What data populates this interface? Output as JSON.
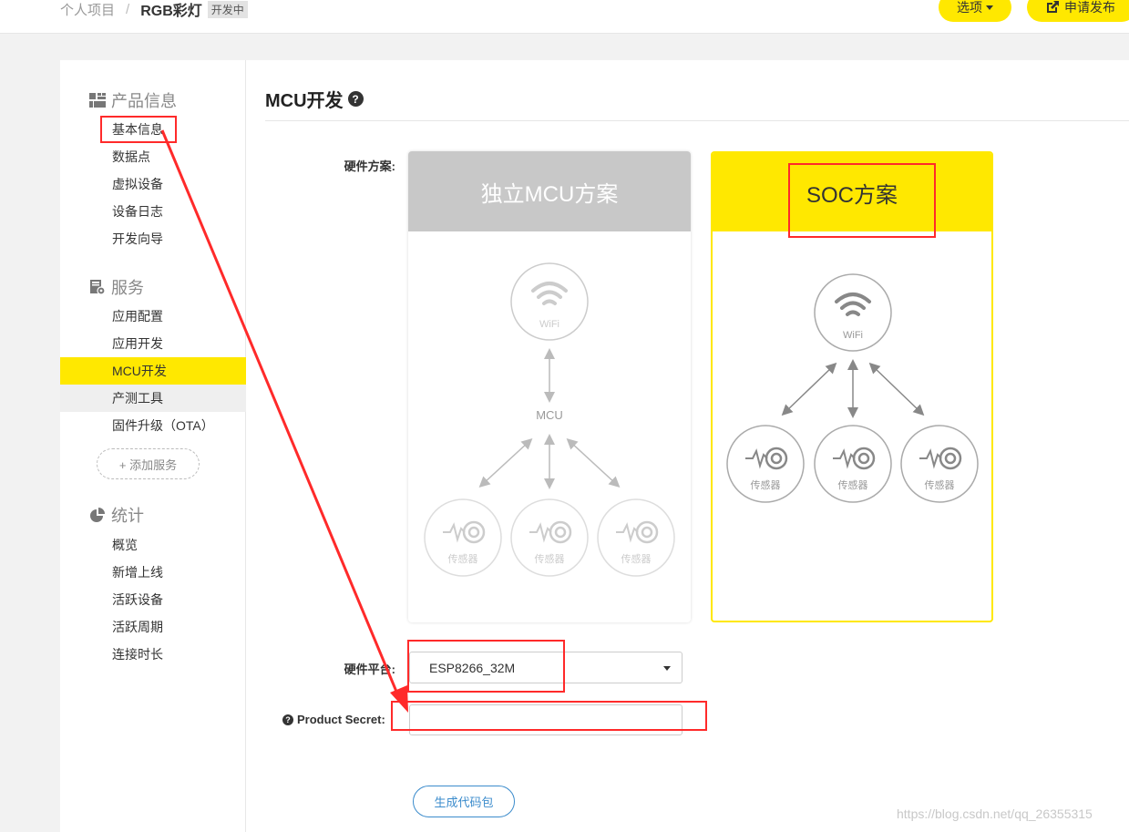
{
  "breadcrumb": {
    "root": "个人项目",
    "separator": "/",
    "project": "RGB彩灯",
    "status": "开发中"
  },
  "header": {
    "options_label": "选项",
    "publish_label": "申请发布"
  },
  "sidebar": {
    "sections": [
      {
        "title": "产品信息",
        "icon": "grid-icon",
        "items": [
          "基本信息",
          "数据点",
          "虚拟设备",
          "设备日志",
          "开发向导"
        ]
      },
      {
        "title": "服务",
        "icon": "service-icon",
        "items": [
          "应用配置",
          "应用开发",
          "MCU开发",
          "产测工具",
          "固件升级（OTA）"
        ]
      },
      {
        "title": "统计",
        "icon": "pie-chart-icon",
        "items": [
          "概览",
          "新增上线",
          "活跃设备",
          "活跃周期",
          "连接时长"
        ]
      }
    ],
    "active_item": "MCU开发",
    "hover_item": "产测工具",
    "add_service_label": "+ 添加服务"
  },
  "main": {
    "title": "MCU开发",
    "hardware_scheme_label": "硬件方案:",
    "schemes": [
      {
        "title": "独立MCU方案",
        "wifi_label": "WiFi",
        "mcu_label": "MCU",
        "sensor_label": "传感器",
        "selected": false
      },
      {
        "title": "SOC方案",
        "wifi_label": "WiFi",
        "sensor_label": "传感器",
        "selected": true
      }
    ],
    "platform_label": "硬件平台:",
    "platform_value": "ESP8266_32M",
    "secret_label": "Product Secret:",
    "secret_value": "",
    "generate_label": "生成代码包"
  },
  "watermark": "https://blog.csdn.net/qq_26355315",
  "colors": {
    "accent": "#ffe800",
    "annotation": "#ff2a2a",
    "link": "#3c8ccc"
  }
}
